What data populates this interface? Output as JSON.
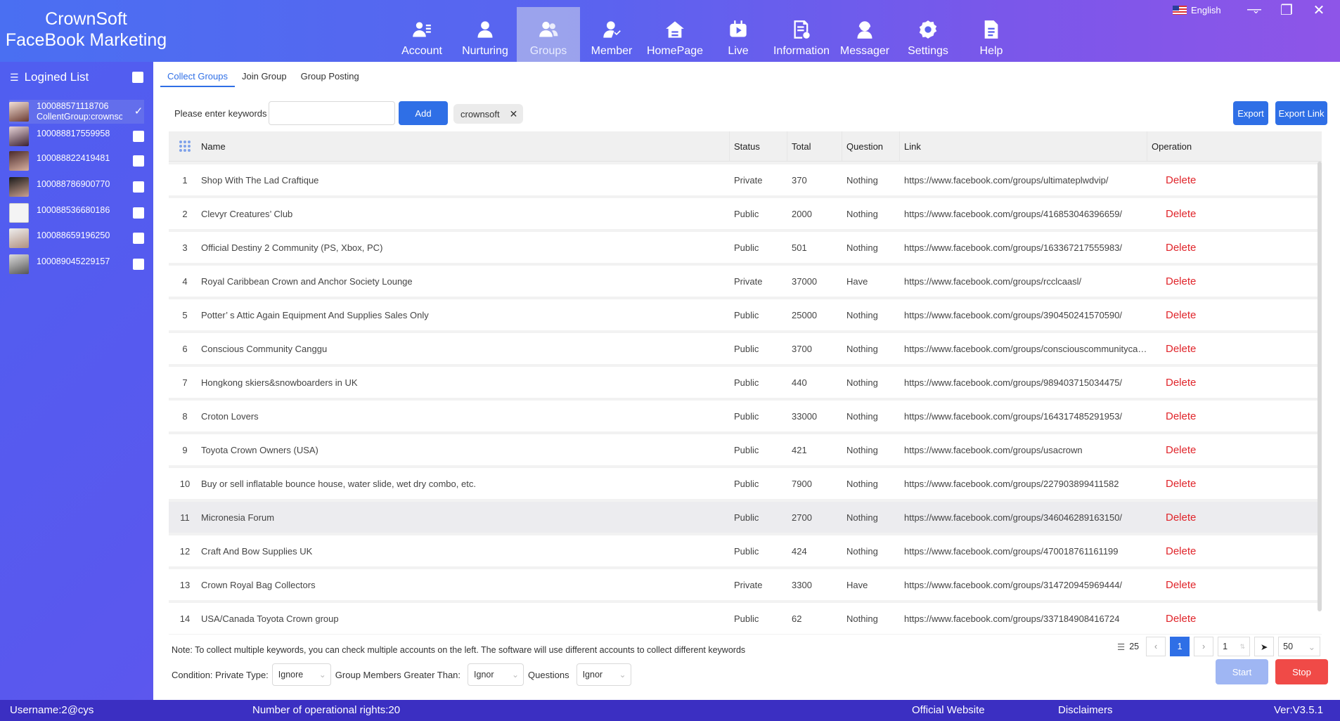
{
  "brand": {
    "line1": "CrownSoft",
    "line2": "FaceBook Marketing"
  },
  "nav": [
    {
      "label": "Account",
      "icon": "account-icon"
    },
    {
      "label": "Nurturing",
      "icon": "user-icon"
    },
    {
      "label": "Groups",
      "icon": "groups-icon",
      "active": true
    },
    {
      "label": "Member",
      "icon": "member-icon"
    },
    {
      "label": "HomePage",
      "icon": "home-icon"
    },
    {
      "label": "Live",
      "icon": "live-icon"
    },
    {
      "label": "Information",
      "icon": "information-icon"
    },
    {
      "label": "Messager",
      "icon": "messager-icon"
    },
    {
      "label": "Settings",
      "icon": "gear-icon"
    },
    {
      "label": "Help",
      "icon": "document-icon"
    }
  ],
  "language": {
    "label": "English"
  },
  "sidebar": {
    "title": "Logined List",
    "accounts": [
      {
        "id": "100088571118706",
        "sub": "CollentGroup:crownsoft",
        "checked": true
      },
      {
        "id": "100088817559958"
      },
      {
        "id": "100088822419481"
      },
      {
        "id": "100088786900770"
      },
      {
        "id": "100088536680186"
      },
      {
        "id": "100088659196250"
      },
      {
        "id": "100089045229157"
      }
    ]
  },
  "tabs": [
    "Collect Groups",
    "Join Group",
    "Group Posting"
  ],
  "keywords": {
    "label": "Please enter keywords",
    "value": "",
    "add_label": "Add",
    "chip": "crownsoft"
  },
  "export": {
    "export_label": "Export",
    "export_link_label": "Export Link"
  },
  "table": {
    "headers": {
      "name": "Name",
      "status": "Status",
      "total": "Total",
      "question": "Question",
      "link": "Link",
      "operation": "Operation"
    },
    "delete_label": "Delete",
    "rows": [
      {
        "idx": "1",
        "name": "Shop With The Lad Craftique",
        "status": "Private",
        "total": "370",
        "question": "Nothing",
        "link": "https://www.facebook.com/groups/ultimateplwdvip/"
      },
      {
        "idx": "2",
        "name": "Clevyr Creatures’   Club",
        "status": "Public",
        "total": "2000",
        "question": "Nothing",
        "link": "https://www.facebook.com/groups/416853046396659/"
      },
      {
        "idx": "3",
        "name": "Official Destiny 2 Community (PS, Xbox, PC)",
        "status": "Public",
        "total": "501",
        "question": "Nothing",
        "link": "https://www.facebook.com/groups/163367217555983/"
      },
      {
        "idx": "4",
        "name": "Royal Caribbean Crown and Anchor Society Lounge",
        "status": "Private",
        "total": "37000",
        "question": "Have",
        "link": "https://www.facebook.com/groups/rcclcaasl/"
      },
      {
        "idx": "5",
        "name": "Potter’   s Attic Again Equipment And Supplies Sales Only",
        "status": "Public",
        "total": "25000",
        "question": "Nothing",
        "link": "https://www.facebook.com/groups/390450241570590/"
      },
      {
        "idx": "6",
        "name": "Conscious Community Canggu",
        "status": "Public",
        "total": "3700",
        "question": "Nothing",
        "link": "https://www.facebook.com/groups/consciouscommunitycanggu/"
      },
      {
        "idx": "7",
        "name": "Hongkong skiers&snowboarders in UK",
        "status": "Public",
        "total": "440",
        "question": "Nothing",
        "link": "https://www.facebook.com/groups/989403715034475/"
      },
      {
        "idx": "8",
        "name": "Croton Lovers",
        "status": "Public",
        "total": "33000",
        "question": "Nothing",
        "link": "https://www.facebook.com/groups/164317485291953/"
      },
      {
        "idx": "9",
        "name": "Toyota Crown Owners (USA)",
        "status": "Public",
        "total": "421",
        "question": "Nothing",
        "link": "https://www.facebook.com/groups/usacrown"
      },
      {
        "idx": "10",
        "name": "Buy or sell inflatable bounce house, water slide, wet dry combo, etc.",
        "status": "Public",
        "total": "7900",
        "question": "Nothing",
        "link": "https://www.facebook.com/groups/227903899411582"
      },
      {
        "idx": "11",
        "name": "Micronesia Forum",
        "status": "Public",
        "total": "2700",
        "question": "Nothing",
        "link": "https://www.facebook.com/groups/346046289163150/",
        "highlight": true
      },
      {
        "idx": "12",
        "name": "Craft And Bow Supplies UK",
        "status": "Public",
        "total": "424",
        "question": "Nothing",
        "link": "https://www.facebook.com/groups/470018761161199"
      },
      {
        "idx": "13",
        "name": "Crown Royal Bag Collectors",
        "status": "Private",
        "total": "3300",
        "question": "Have",
        "link": "https://www.facebook.com/groups/314720945969444/"
      },
      {
        "idx": "14",
        "name": "USA/Canada Toyota Crown group",
        "status": "Public",
        "total": "62",
        "question": "Nothing",
        "link": "https://www.facebook.com/groups/337184908416724"
      }
    ]
  },
  "note": "Note: To collect multiple keywords, you can check multiple accounts on the left. The software will use different accounts to collect different keywords",
  "conditions": {
    "private_label": "Condition: Private Type:",
    "private_value": "Ignore",
    "members_label": "Group Members Greater Than:",
    "members_value": "Ignor",
    "questions_label": "Questions",
    "questions_value": "Ignor"
  },
  "pagination": {
    "total": "25",
    "current_page": "1",
    "goto_value": "1",
    "page_size": "50"
  },
  "actions": {
    "start_label": "Start",
    "stop_label": "Stop"
  },
  "statusbar": {
    "username": "Username:2@cys",
    "rights": "Number of operational rights:20",
    "website": "Official Website",
    "disclaimers": "Disclaimers",
    "version": "Ver:V3.5.1"
  },
  "colors": {
    "accent": "#2f6fe6",
    "danger": "#e0242a",
    "stop": "#f04a47",
    "start_disabled": "#9fb6f3",
    "statusbar": "#3b2fc2"
  }
}
